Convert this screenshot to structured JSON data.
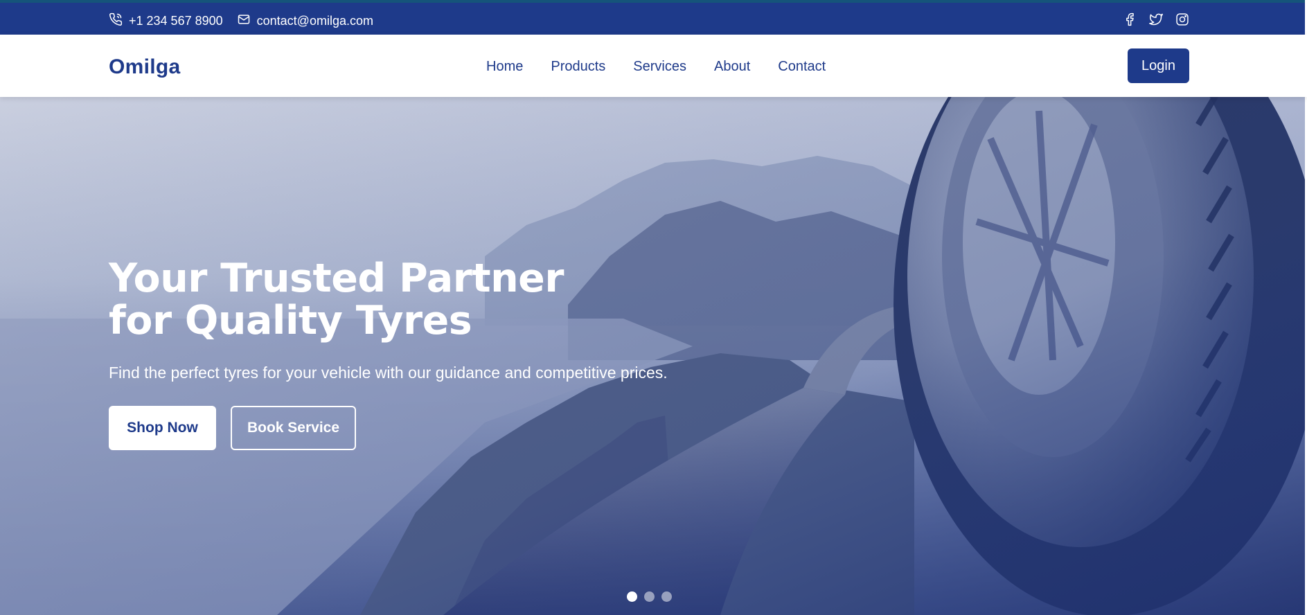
{
  "topbar": {
    "phone": "+1 234 567 8900",
    "email": "contact@omilga.com",
    "phone_icon": "phone-icon",
    "email_icon": "mail-icon",
    "social": [
      "facebook-icon",
      "twitter-icon",
      "instagram-icon"
    ]
  },
  "nav": {
    "logo": "Omilga",
    "items": [
      "Home",
      "Products",
      "Services",
      "About",
      "Contact"
    ],
    "login": "Login"
  },
  "hero": {
    "title": "Your Trusted Partner for Quality Tyres",
    "subtitle": "Find the perfect tyres for your vehicle with our guidance and competitive prices.",
    "primary_button": "Shop Now",
    "secondary_button": "Book Service",
    "slides": 3,
    "active_slide": 1
  },
  "colors": {
    "brand": "#1e3a8a",
    "topbar_accent": "#15547a",
    "white": "#ffffff"
  }
}
